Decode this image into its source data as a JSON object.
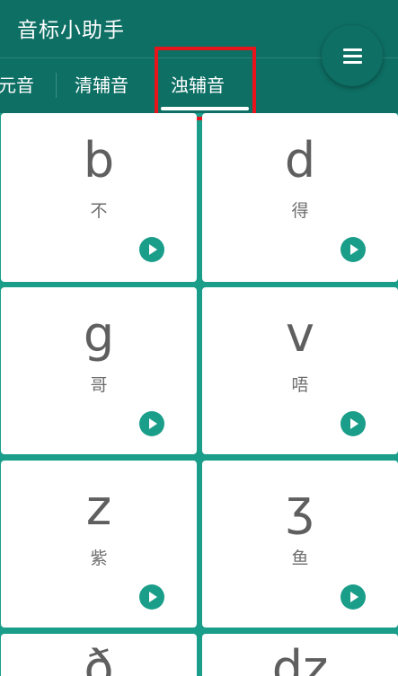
{
  "app": {
    "title": "音标小助手"
  },
  "tabs": [
    {
      "label": "元音"
    },
    {
      "label": "清辅音"
    },
    {
      "label": "浊辅音",
      "selected": true
    }
  ],
  "menu": {
    "icon": "menu-icon"
  },
  "cards": [
    {
      "symbol": "b",
      "hint": "不"
    },
    {
      "symbol": "d",
      "hint": "得"
    },
    {
      "symbol": "g",
      "hint": "哥"
    },
    {
      "symbol": "v",
      "hint": "唔"
    },
    {
      "symbol": "z",
      "hint": "紫"
    },
    {
      "symbol": "ʒ",
      "hint": "鱼"
    },
    {
      "symbol": "ð",
      "hint": ""
    },
    {
      "symbol": "dz",
      "hint": ""
    }
  ],
  "colors": {
    "primary": "#0e6f64",
    "accent": "#1a9e8a",
    "card": "#ffffff",
    "highlight": "#e8141c"
  }
}
